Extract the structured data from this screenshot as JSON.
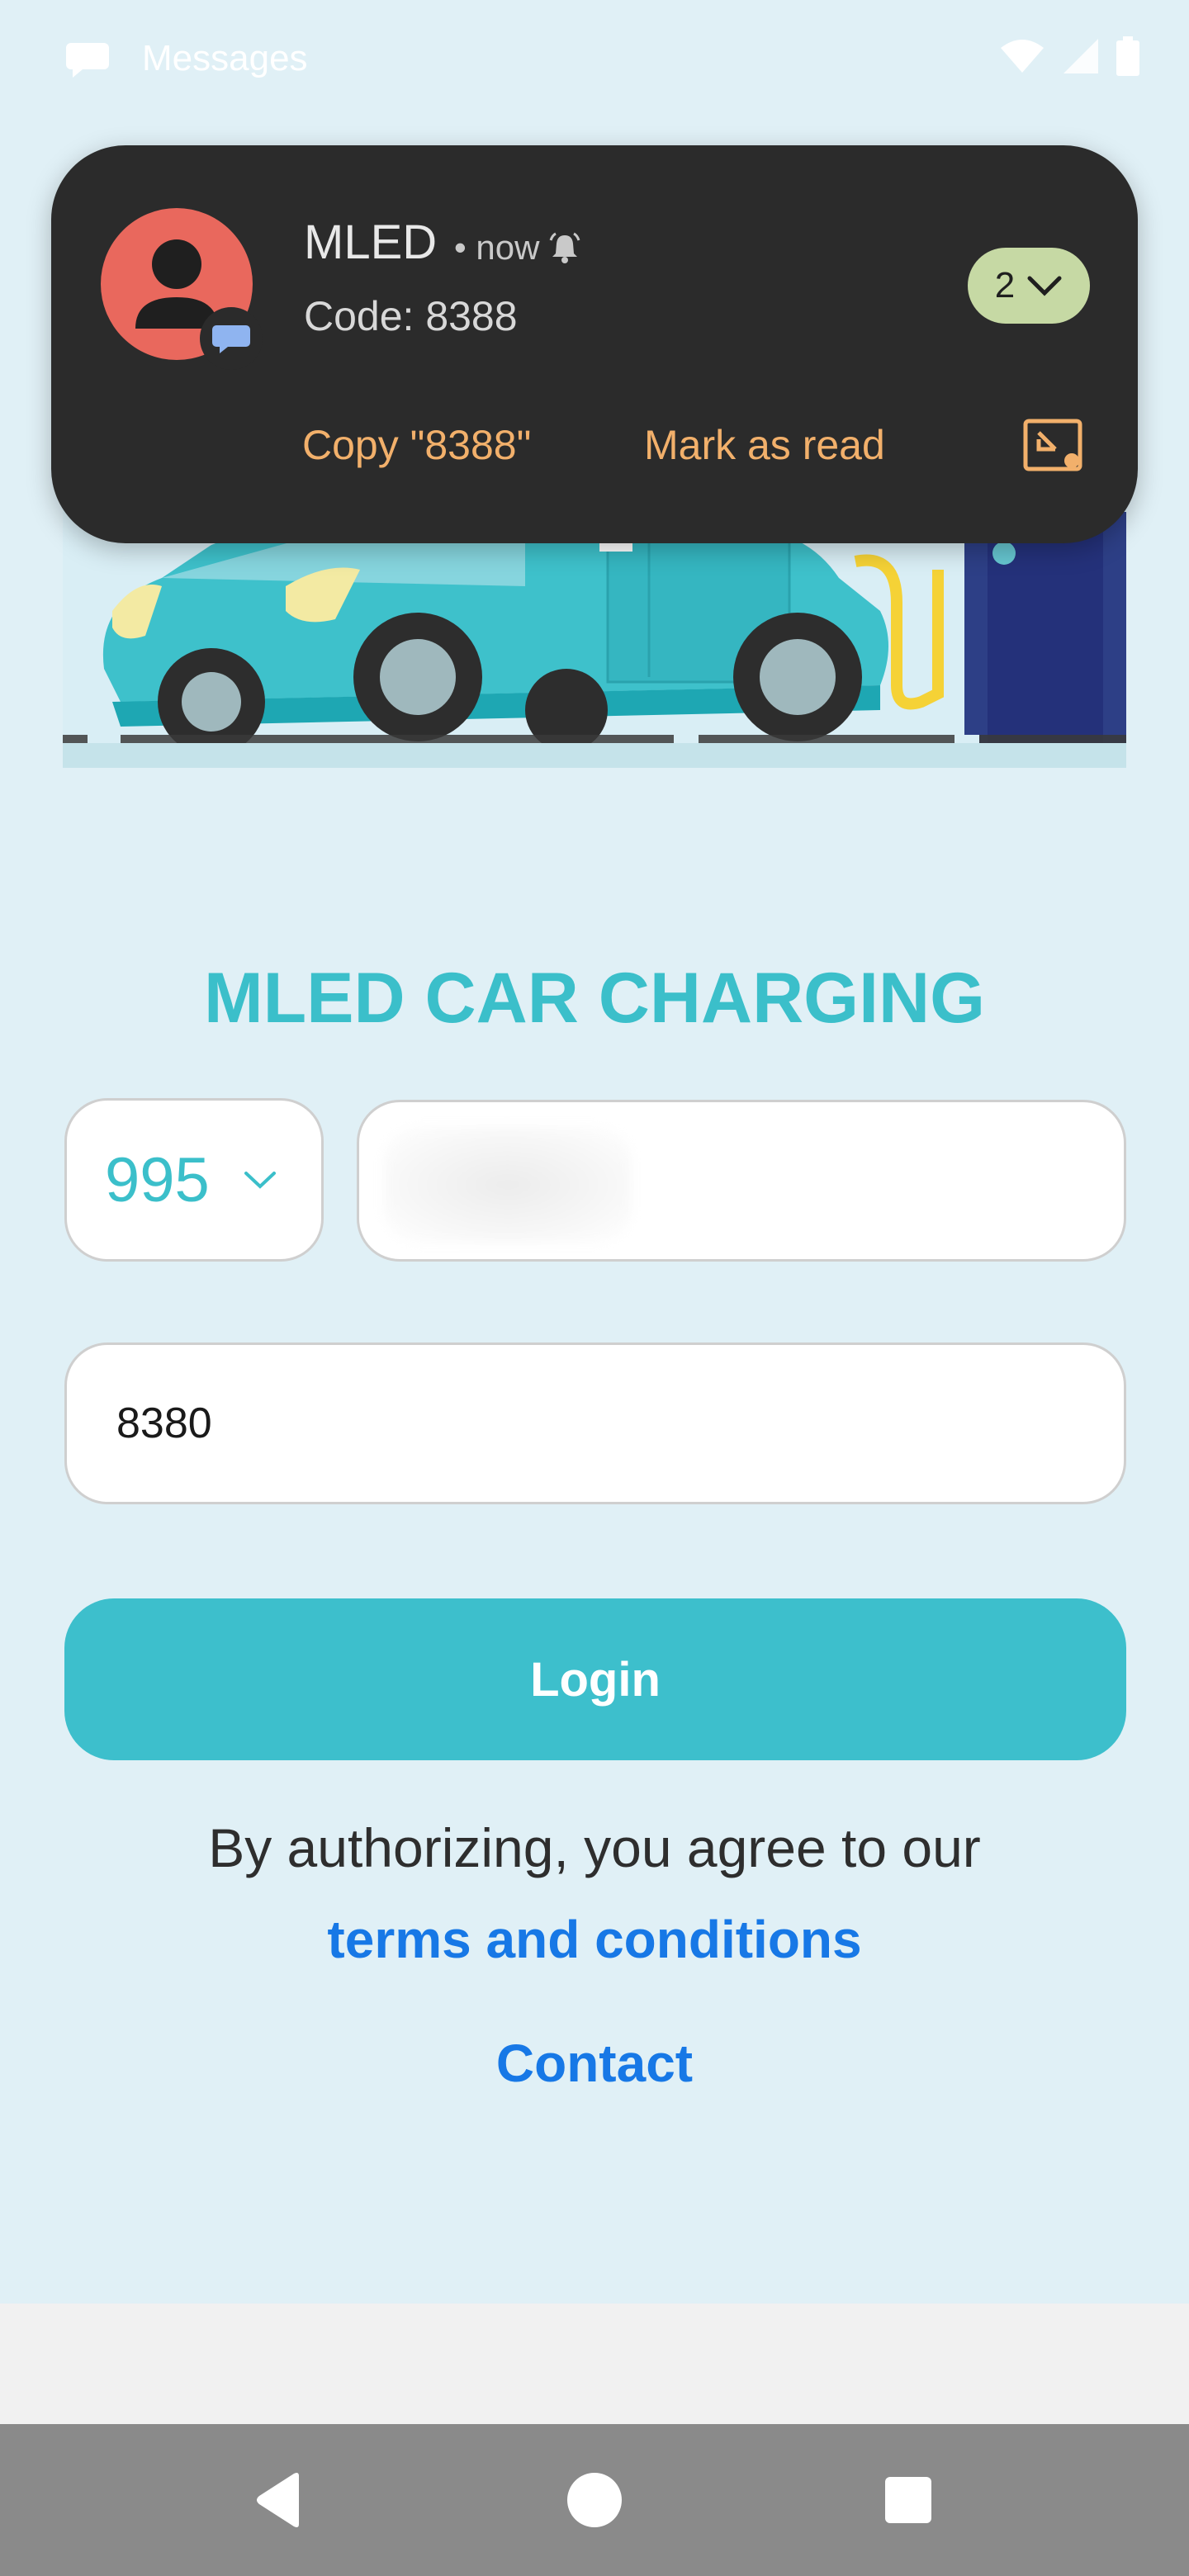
{
  "status_bar": {
    "app_name": "Messages"
  },
  "notification": {
    "sender": "MLED",
    "time": "• now",
    "body": "Code: 8388",
    "count": "2",
    "actions": {
      "copy": "Copy \"8388\"",
      "mark_read": "Mark as read"
    }
  },
  "page": {
    "title": "MLED CAR CHARGING",
    "country_code": "995",
    "phone_value": "",
    "code_value": "8380",
    "login_label": "Login",
    "agree_text": "By authorizing, you agree to our",
    "terms_link": "terms and conditions",
    "contact_link": "Contact"
  },
  "colors": {
    "accent": "#3bbfca",
    "link": "#1778e6",
    "notification_bg": "#2b2b2b",
    "notification_action": "#f2b06b",
    "avatar": "#e9685d"
  }
}
